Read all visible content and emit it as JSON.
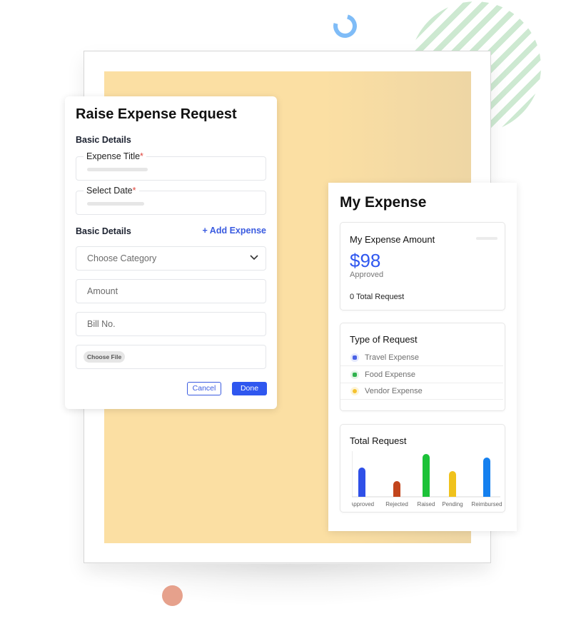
{
  "raise_card": {
    "title": "Raise Expense Request",
    "section_basic": "Basic Details",
    "expense_title": {
      "label": "Expense Title",
      "required": "*"
    },
    "select_date": {
      "label": "Select Date",
      "required": "*"
    },
    "section_expense": "Basic Details",
    "add_expense": "+ Add Expense",
    "category": {
      "placeholder": "Choose Category",
      "icon": "chevron-down-icon"
    },
    "amount": {
      "placeholder": "Amount"
    },
    "bill_no": {
      "placeholder": "Bill No."
    },
    "file": {
      "button": "Choose File"
    },
    "cancel": "Cancel",
    "done": "Done"
  },
  "my_expense": {
    "title": "My Expense",
    "amount_card": {
      "heading": "My Expense Amount",
      "amount": "$98",
      "status": "Approved",
      "total": "0 Total Request"
    },
    "type_card": {
      "heading": "Type of Request",
      "items": [
        {
          "label": "Travel Expense",
          "icon": "briefcase-icon",
          "color": "#4a62e6",
          "bg": "#e4e9fd"
        },
        {
          "label": "Food Expense",
          "icon": "food-icon",
          "color": "#2fb24d",
          "bg": "#e2f5e6"
        },
        {
          "label": "Vendor Expense",
          "icon": "coin-icon",
          "color": "#f5c22e",
          "bg": "#fdf4d6"
        }
      ]
    },
    "total_card": {
      "heading": "Total Request"
    }
  },
  "colors": {
    "accent": "#2f57ef",
    "required": "#e0453c",
    "frame_fill": "#fbdfa3"
  },
  "chart_data": {
    "type": "bar",
    "title": "Total Request",
    "categories": [
      "Approved",
      "Rejected",
      "Raised",
      "Pending",
      "Reimbursed"
    ],
    "values": [
      41,
      22,
      60,
      36,
      55
    ],
    "colors": [
      "#2f50e8",
      "#c2451c",
      "#1cc238",
      "#f0c21c",
      "#1580ef"
    ],
    "xlabel": "",
    "ylabel": "",
    "ylim": [
      0,
      64
    ],
    "grid": false
  }
}
